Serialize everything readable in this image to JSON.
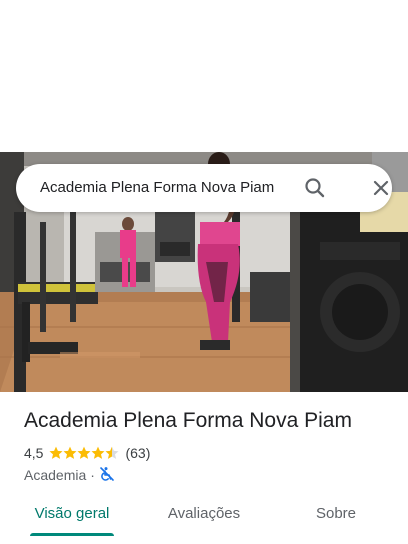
{
  "search": {
    "query": "Academia Plena Forma Nova Piam",
    "search_icon": "search-icon",
    "close_icon": "close-icon"
  },
  "photo": {
    "description_icon": "gym-photo"
  },
  "place": {
    "name": "Academia Plena Forma Nova Piam",
    "rating": "4,5",
    "rating_fraction": 0.9,
    "review_count": "(63)",
    "category": "Academia",
    "separator": "·",
    "accessibility_icon": "not-accessible-icon"
  },
  "tabs": [
    {
      "label": "Visão geral",
      "selected": true
    },
    {
      "label": "Avaliações",
      "selected": false
    },
    {
      "label": "Sobre",
      "selected": false
    }
  ],
  "colors": {
    "accent": "#00796b",
    "star": "#fbbc04",
    "accessibility": "#1a73e8"
  }
}
